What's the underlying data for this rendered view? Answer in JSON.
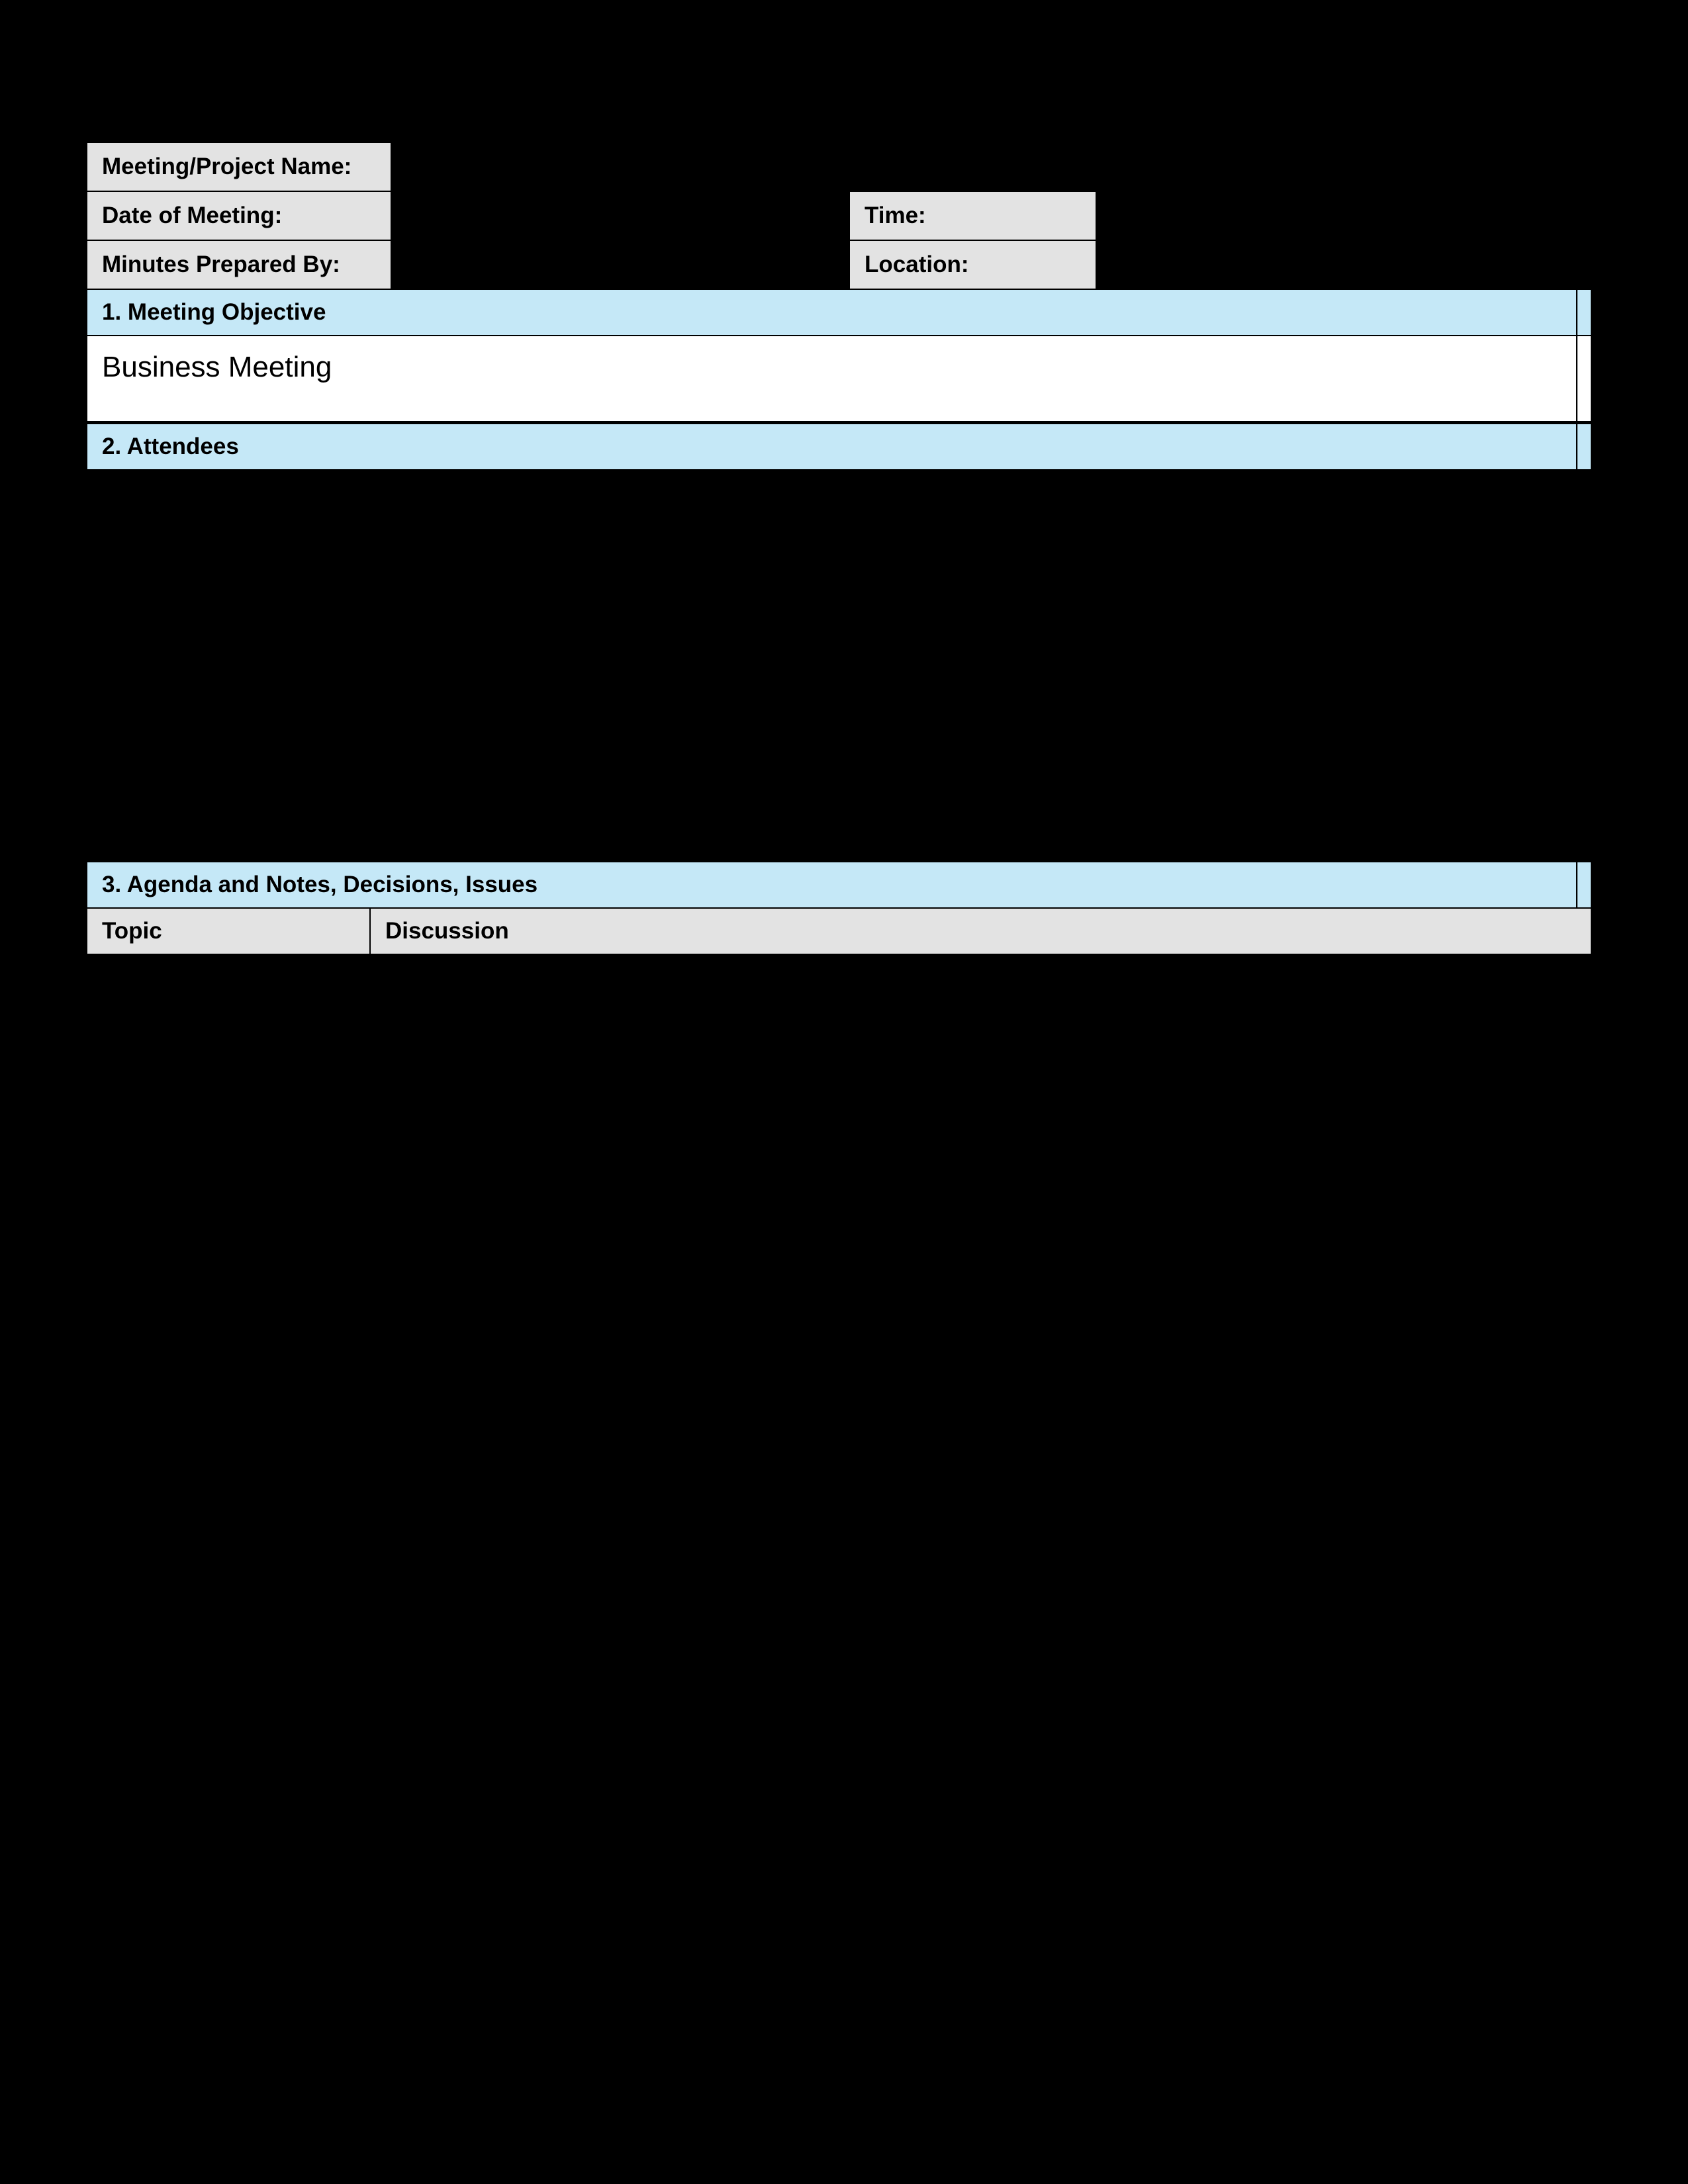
{
  "header": {
    "meeting_project_name_label": "Meeting/Project Name:",
    "date_of_meeting_label": "Date of Meeting:",
    "time_label": "Time:",
    "minutes_prepared_by_label": "Minutes Prepared By:",
    "location_label": "Location:"
  },
  "sections": {
    "objective": {
      "title": "1. Meeting Objective",
      "content": "Business Meeting"
    },
    "attendees": {
      "title": "2. Attendees"
    },
    "agenda": {
      "title": "3. Agenda and Notes, Decisions, Issues",
      "columns": {
        "topic": "Topic",
        "discussion": "Discussion"
      }
    }
  }
}
